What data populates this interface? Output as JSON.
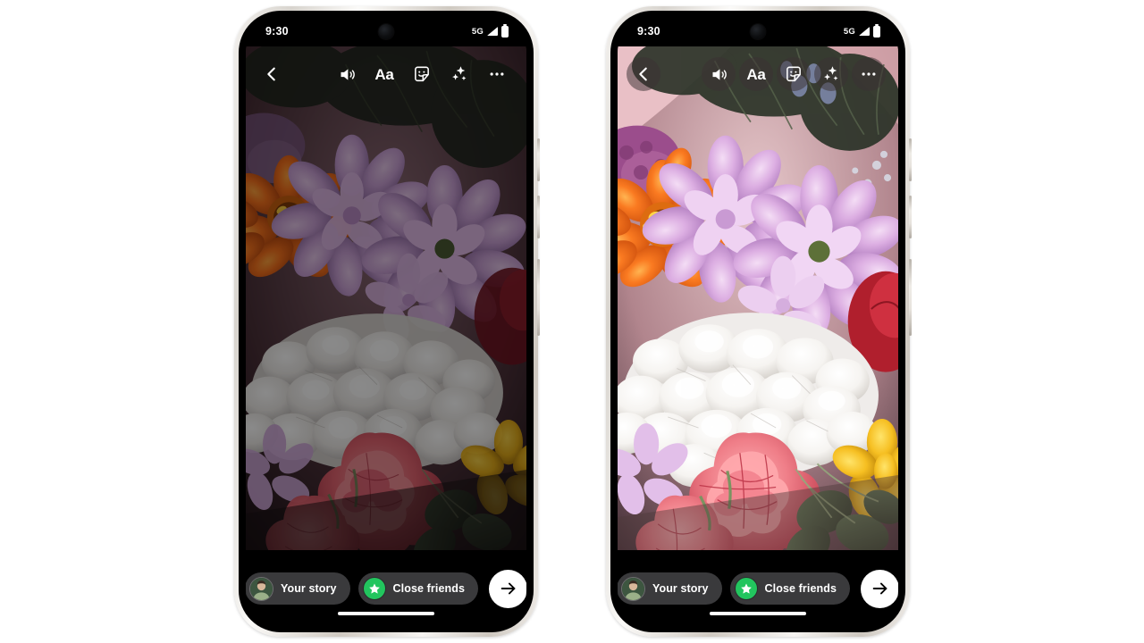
{
  "background_color": "#ffffff",
  "accent_colors": {
    "close_friends_green": "#22c55e",
    "pill_grey": "#3a3a3c",
    "send_button_white": "#ffffff",
    "chip_overlay": "rgba(60,50,52,0.52)"
  },
  "phones": [
    {
      "id": "left-phone",
      "variant": "dimmed-preview",
      "status_bar": {
        "time": "9:30",
        "network": "5G",
        "signal_icon": "signal-bars-icon",
        "battery_icon": "battery-full-icon",
        "camera_icon": "front-camera-punch-hole"
      },
      "top_toolbar": {
        "chips_visible": false,
        "back_label": "Back",
        "back_icon": "chevron-left-icon",
        "actions": [
          {
            "name": "sound-toggle",
            "icon": "speaker-volume-icon",
            "label": "Sound"
          },
          {
            "name": "text-tool",
            "icon": "text-aa-icon",
            "label": "Aa"
          },
          {
            "name": "sticker-tool",
            "icon": "sticker-smiley-icon",
            "label": "Stickers"
          },
          {
            "name": "effects-tool",
            "icon": "sparkles-icon",
            "label": "Effects"
          },
          {
            "name": "more-options",
            "icon": "more-horizontal-icon",
            "label": "More"
          }
        ]
      },
      "media": {
        "type": "photo",
        "description": "flower bouquet",
        "brightness": "dim"
      },
      "bottom_bar": {
        "your_story_label": "Your story",
        "your_story_icon": "user-avatar",
        "close_friends_label": "Close friends",
        "close_friends_icon": "green-star-icon",
        "send_label": "Send",
        "send_icon": "arrow-right-icon",
        "home_indicator": true
      }
    },
    {
      "id": "right-phone",
      "variant": "bright-preview-with-chips",
      "status_bar": {
        "time": "9:30",
        "network": "5G",
        "signal_icon": "signal-bars-icon",
        "battery_icon": "battery-full-icon",
        "camera_icon": "front-camera-punch-hole"
      },
      "top_toolbar": {
        "chips_visible": true,
        "back_label": "Back",
        "back_icon": "chevron-left-icon",
        "actions": [
          {
            "name": "sound-toggle",
            "icon": "speaker-volume-icon",
            "label": "Sound"
          },
          {
            "name": "text-tool",
            "icon": "text-aa-icon",
            "label": "Aa"
          },
          {
            "name": "sticker-tool",
            "icon": "sticker-smiley-icon",
            "label": "Stickers"
          },
          {
            "name": "effects-tool",
            "icon": "sparkles-icon",
            "label": "Effects"
          },
          {
            "name": "more-options",
            "icon": "more-horizontal-icon",
            "label": "More"
          }
        ]
      },
      "media": {
        "type": "photo",
        "description": "flower bouquet",
        "brightness": "normal"
      },
      "bottom_bar": {
        "your_story_label": "Your story",
        "your_story_icon": "user-avatar",
        "close_friends_label": "Close friends",
        "close_friends_icon": "green-star-icon",
        "send_label": "Send",
        "send_icon": "arrow-right-icon",
        "home_indicator": true
      }
    }
  ]
}
